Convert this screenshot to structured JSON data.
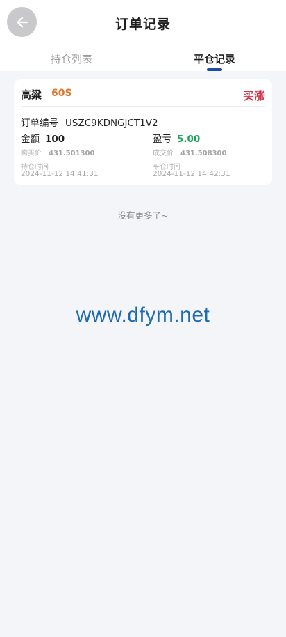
{
  "header": {
    "title": "订单记录",
    "back_icon": "arrow-left-icon"
  },
  "tabs": [
    {
      "label": "持仓列表",
      "active": false
    },
    {
      "label": "平仓记录",
      "active": true
    }
  ],
  "colors": {
    "accent": "#1e4aa8",
    "period": "#e0762a",
    "buy_up": "#d2344a",
    "profit": "#1ea65a",
    "watermark": "#1e6bb0"
  },
  "record": {
    "product": "高粱",
    "period": "60S",
    "direction": "买涨",
    "order_label": "订单编号",
    "order_no": "USZC9KDNGJCT1V2",
    "amount_label": "金额",
    "amount": "100",
    "profit_label": "盈亏",
    "profit": "5.00",
    "buy_price_label": "购买价",
    "buy_price": "431.501300",
    "deal_price_label": "成交价",
    "deal_price": "431.508300",
    "hold_time_label": "持仓时间",
    "hold_time": "2024-11-12 14:41:31",
    "close_time_label": "平仓时间",
    "close_time": "2024-11-12 14:42:31"
  },
  "list_end_text": "没有更多了~",
  "watermark": "www.dfym.net"
}
